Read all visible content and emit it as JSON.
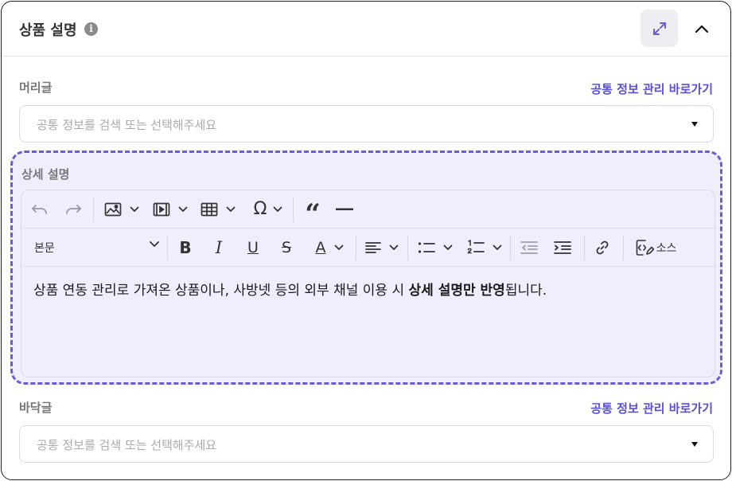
{
  "header": {
    "title": "상품 설명",
    "info_icon": "info-icon",
    "expand_icon": "expand-diagonal-icon",
    "collapse_icon": "chevron-up-icon"
  },
  "header_field": {
    "label": "머리글",
    "link": "공통 정보 관리 바로가기",
    "placeholder": "공통 정보를 검색 또는 선택해주세요"
  },
  "detail": {
    "label": "상세 설명",
    "toolbar_row1": [
      "undo-icon",
      "redo-icon",
      "image-icon",
      "video-icon",
      "table-icon",
      "omega-icon",
      "blockquote-icon",
      "horizontal-rule-icon"
    ],
    "font_style": "본문",
    "toolbar_row2": [
      "bold-icon",
      "italic-icon",
      "underline-icon",
      "strikethrough-icon",
      "font-color-icon",
      "align-icon",
      "bullet-list-icon",
      "numbered-list-icon",
      "outdent-icon",
      "indent-icon",
      "link-icon",
      "source-code-icon"
    ],
    "source_label": "소스",
    "content_prefix": "상품 연동 관리로 가져온 상품이나, 사방넷 등의 외부 채널 이용 시 ",
    "content_bold": "상세 설명만 반영",
    "content_suffix": "됩니다."
  },
  "footer_field": {
    "label": "바닥글",
    "link": "공통 정보 관리 바로가기",
    "placeholder": "공통 정보를 검색 또는 선택해주세요"
  },
  "colors": {
    "accent": "#5b4fd6",
    "dashed_border": "#6a5bd8",
    "editor_bg": "#efeefd"
  }
}
